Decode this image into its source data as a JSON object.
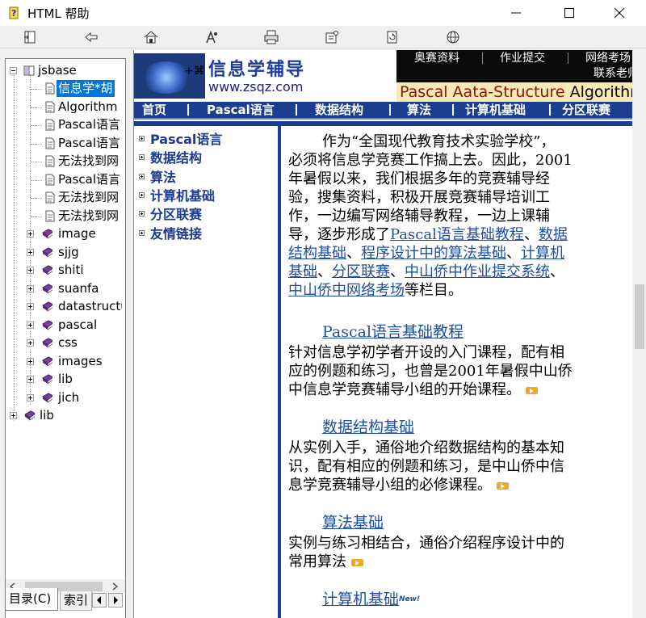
{
  "window": {
    "title": "HTML 帮助"
  },
  "toolbar": {
    "buttons": [
      "show-hide",
      "back",
      "home",
      "font",
      "print",
      "options",
      "refresh",
      "web"
    ]
  },
  "nav": {
    "root": "jsbase",
    "items": [
      {
        "label": "信息学*胡",
        "type": "page",
        "selected": true
      },
      {
        "label": "Algorithm a",
        "type": "page"
      },
      {
        "label": "Pascal语言",
        "type": "page"
      },
      {
        "label": "Pascal语言",
        "type": "page"
      },
      {
        "label": "无法找到网",
        "type": "page"
      },
      {
        "label": "Pascal语言",
        "type": "page"
      },
      {
        "label": "无法找到网",
        "type": "page"
      },
      {
        "label": "无法找到网",
        "type": "page"
      }
    ],
    "folders": [
      "image",
      "sjjg",
      "shiti",
      "suanfa",
      "datastructu",
      "pascal",
      "css",
      "images",
      "lib",
      "jich"
    ],
    "root2": "lib",
    "tabs": {
      "contents": "目录(C)",
      "index": "索引"
    }
  },
  "banner": {
    "site_title": "信息学辅导",
    "url": "www.zsqz.com",
    "symbols": "+⌘",
    "top_links": [
      "奥赛资料",
      "作业提交",
      "网络考场",
      "联系老师"
    ],
    "slogan_part1": "Pascal Aata-Structure ",
    "slogan_part2": "Algorithm"
  },
  "main_nav": [
    "首页",
    "Pascal语言",
    "数据结构",
    "算法",
    "计算机基础",
    "分区联赛"
  ],
  "side_menu": [
    "Pascal语言",
    "数据结构",
    "算法",
    "计算机基础",
    "分区联赛",
    "友情链接"
  ],
  "intro": {
    "l1": "作为“全国现代教育技术实验学校”，",
    "l2": "必须将信息学竞赛工作搞上去。因此，2001",
    "l3": "年暑假以来，我们根据多年的竞赛辅导经",
    "l4": "验，搜集资料，积极开展竞赛辅导培训工",
    "l5": "作，一边编写网络辅导教程，一边上课辅",
    "l6a": "导，逐步形成了",
    "l6link1": "Pascal语言基础教程",
    "l6b": "、",
    "l6link2": "数据",
    "l7link2": "结构基础",
    "l7a": "、",
    "l7link3": "程序设计中的算法基础",
    "l7b": "、",
    "l7link4": "计算机",
    "l8link4": "基础",
    "l8a": "、",
    "l8link5": "分区联赛",
    "l8b": "、",
    "l8link6": "中山侨中作业提交系统",
    "l8c": "、",
    "l9link7": "中山侨中网络考场",
    "l9a": "等栏目。"
  },
  "sections": [
    {
      "title": "Pascal语言基础教程",
      "lines": [
        "针对信息学初学者开设的入门课程，配有相",
        "应的例题和练习，也曾是2001年暑假中山侨",
        "中信息学竞赛辅导小组的开始课程。"
      ]
    },
    {
      "title": "数据结构基础",
      "lines": [
        "从实例入手，通俗地介绍数据结构的基本知",
        "识，配有相应的例题和练习，是中山侨中信",
        "息学竞赛辅导小组的必修课程。"
      ]
    },
    {
      "title": "算法基础",
      "lines": [
        "实例与练习相结合，通俗介绍程序设计中的",
        "常用算法"
      ]
    },
    {
      "title": "计算机基础",
      "badge": "New!",
      "lines": []
    }
  ]
}
